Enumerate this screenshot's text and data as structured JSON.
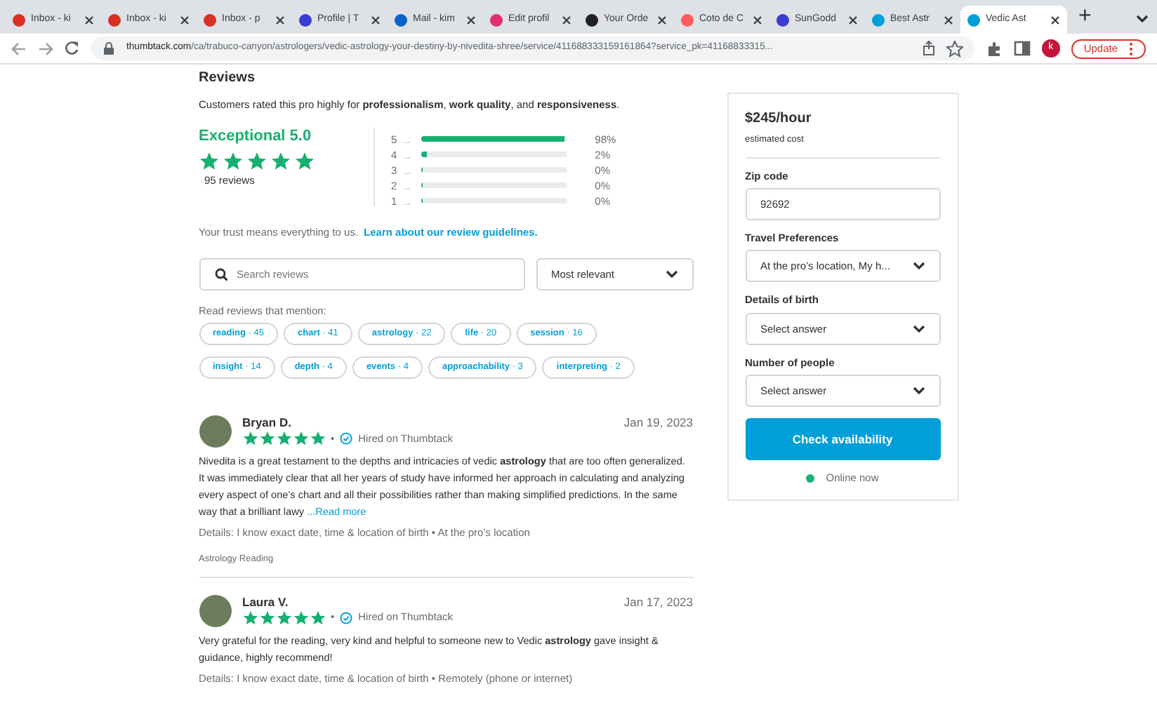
{
  "browser": {
    "tabs": [
      {
        "title": "Inbox - ki",
        "color": "#d93025",
        "selected": false
      },
      {
        "title": "Inbox - ki",
        "color": "#d93025",
        "selected": false
      },
      {
        "title": "Inbox - p",
        "color": "#d93025",
        "selected": false
      },
      {
        "title": "Profile | T",
        "color": "#3b3bd6",
        "selected": false
      },
      {
        "title": "Mail - kim",
        "color": "#0a64c8",
        "selected": false
      },
      {
        "title": "Edit profil",
        "color": "#e1306c",
        "selected": false
      },
      {
        "title": "Your Orde",
        "color": "#222222",
        "selected": false
      },
      {
        "title": "Coto de C",
        "color": "#ff5a5f",
        "selected": false
      },
      {
        "title": "SunGodd",
        "color": "#3b3bd6",
        "selected": false
      },
      {
        "title": "Best Astr",
        "color": "#009fd9",
        "selected": false
      },
      {
        "title": "Vedic Ast",
        "color": "#009fd9",
        "selected": true
      }
    ],
    "new_tab": "+",
    "host": "thumbtack.com",
    "path": "/ca/trabuco-canyon/astrologers/vedic-astrology-your-destiny-by-nivedita-shree/service/411688333159161864?service_pk=41168833315...",
    "profile_initial": "k",
    "update_button": "Update"
  },
  "reviews": {
    "title": "Reviews",
    "summary": "Customers rated this pro highly for **professionalism**, **work quality**, and **responsiveness**.",
    "rating_label": "Exceptional 5.0",
    "stars": 5,
    "count": "95 reviews",
    "distribution": [
      {
        "star": "5",
        "level": 0.98,
        "percent": "98%"
      },
      {
        "star": "4",
        "level": 0.02,
        "percent": "2%"
      },
      {
        "star": "3",
        "level": 0,
        "percent": "0%"
      },
      {
        "star": "2",
        "level": 0,
        "percent": "0%"
      },
      {
        "star": "1",
        "level": 0,
        "percent": "0%"
      }
    ],
    "trust_text": "Your trust means everything to us.",
    "guidelines_link": "Learn about our review guidelines.",
    "search": {
      "placeholder": "Search reviews"
    },
    "sort": "Most relevant",
    "mention_label": "Read reviews that mention:",
    "mention_rows": [
      [
        {
          "label": "**reading** · 45"
        },
        {
          "label": "**chart** · 41"
        },
        {
          "label": "**astrology** · 22"
        },
        {
          "label": "**life** · 20"
        },
        {
          "label": "**session** · 16"
        }
      ],
      [
        {
          "label": "**insight** · 14"
        },
        {
          "label": "**depth** · 4"
        },
        {
          "label": "**events** · 4"
        },
        {
          "label": "**approachability** · 3"
        },
        {
          "label": "**interpreting** · 2"
        }
      ]
    ],
    "items": [
      {
        "name": "Bryan D.",
        "date": "Jan 19, 2023",
        "stars": 5,
        "separator": "•",
        "hired": "Hired on Thumbtack",
        "text": "Nivedita is a great testament to the depths and intricacies of vedic **astrology** that are too often generalized. It was immediately clear that all her years of study have informed her approach in calculating and analyzing every aspect of one’s chart and all their possibilities rather than making simplified predictions. In the same way that a brilliant lawy",
        "read_more": "...Read more",
        "details": "Details: I know exact date, time & location of birth • At the pro’s location",
        "category": "Astrology Reading"
      },
      {
        "name": "Laura V.",
        "date": "Jan 17, 2023",
        "stars": 5,
        "separator": "•",
        "hired": "Hired on Thumbtack",
        "text": "Very grateful for the reading, very kind and helpful to someone new to Vedic **astrology** gave insight & guidance, highly recommend!",
        "details": "Details: I know exact date, time & location of birth • Remotely (phone or internet)"
      }
    ]
  },
  "booking": {
    "price": "$245/hour",
    "price_note": "estimated cost",
    "fields": [
      {
        "kind": "input",
        "label": "Zip code",
        "value": "92692"
      },
      {
        "kind": "select",
        "label": "Travel Preferences",
        "value": "At the pro’s location, My h..."
      },
      {
        "kind": "select",
        "label": "Details of birth",
        "value": "Select answer"
      },
      {
        "kind": "select",
        "label": "Number of people",
        "value": "Select answer"
      }
    ],
    "button": "Check availability",
    "status": "Online now"
  }
}
